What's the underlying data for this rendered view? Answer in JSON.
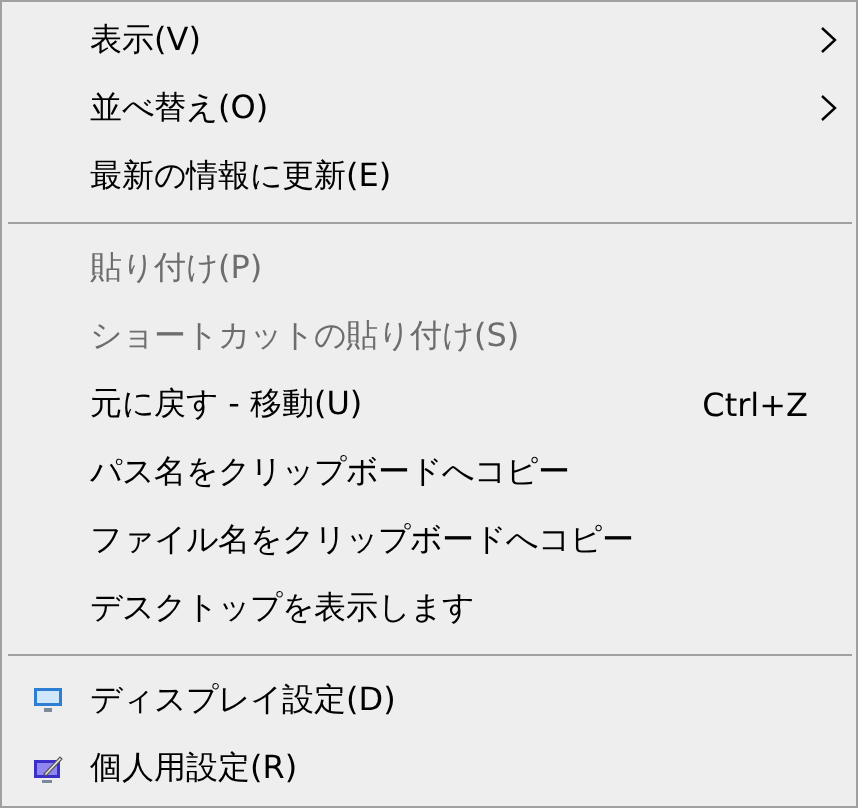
{
  "menu": {
    "items": [
      {
        "kind": "command",
        "label": "表示(V)",
        "disabled": false,
        "submenu": true
      },
      {
        "kind": "command",
        "label": "並べ替え(O)",
        "disabled": false,
        "submenu": true
      },
      {
        "kind": "command",
        "label": "最新の情報に更新(E)",
        "disabled": false,
        "submenu": false
      },
      {
        "kind": "separator"
      },
      {
        "kind": "command",
        "label": "貼り付け(P)",
        "disabled": true,
        "submenu": false
      },
      {
        "kind": "command",
        "label": "ショートカットの貼り付け(S)",
        "disabled": true,
        "submenu": false
      },
      {
        "kind": "command",
        "label": "元に戻す - 移動(U)",
        "disabled": false,
        "submenu": false,
        "shortcut": "Ctrl+Z"
      },
      {
        "kind": "command",
        "label": "パス名をクリップボードへコピー",
        "disabled": false,
        "submenu": false
      },
      {
        "kind": "command",
        "label": "ファイル名をクリップボードへコピー",
        "disabled": false,
        "submenu": false
      },
      {
        "kind": "command",
        "label": "デスクトップを表示します",
        "disabled": false,
        "submenu": false
      },
      {
        "kind": "separator"
      },
      {
        "kind": "display",
        "label": "ディスプレイ設定(D)",
        "disabled": false,
        "submenu": false
      },
      {
        "kind": "personalize",
        "label": "個人用設定(R)",
        "disabled": false,
        "submenu": false
      }
    ]
  }
}
